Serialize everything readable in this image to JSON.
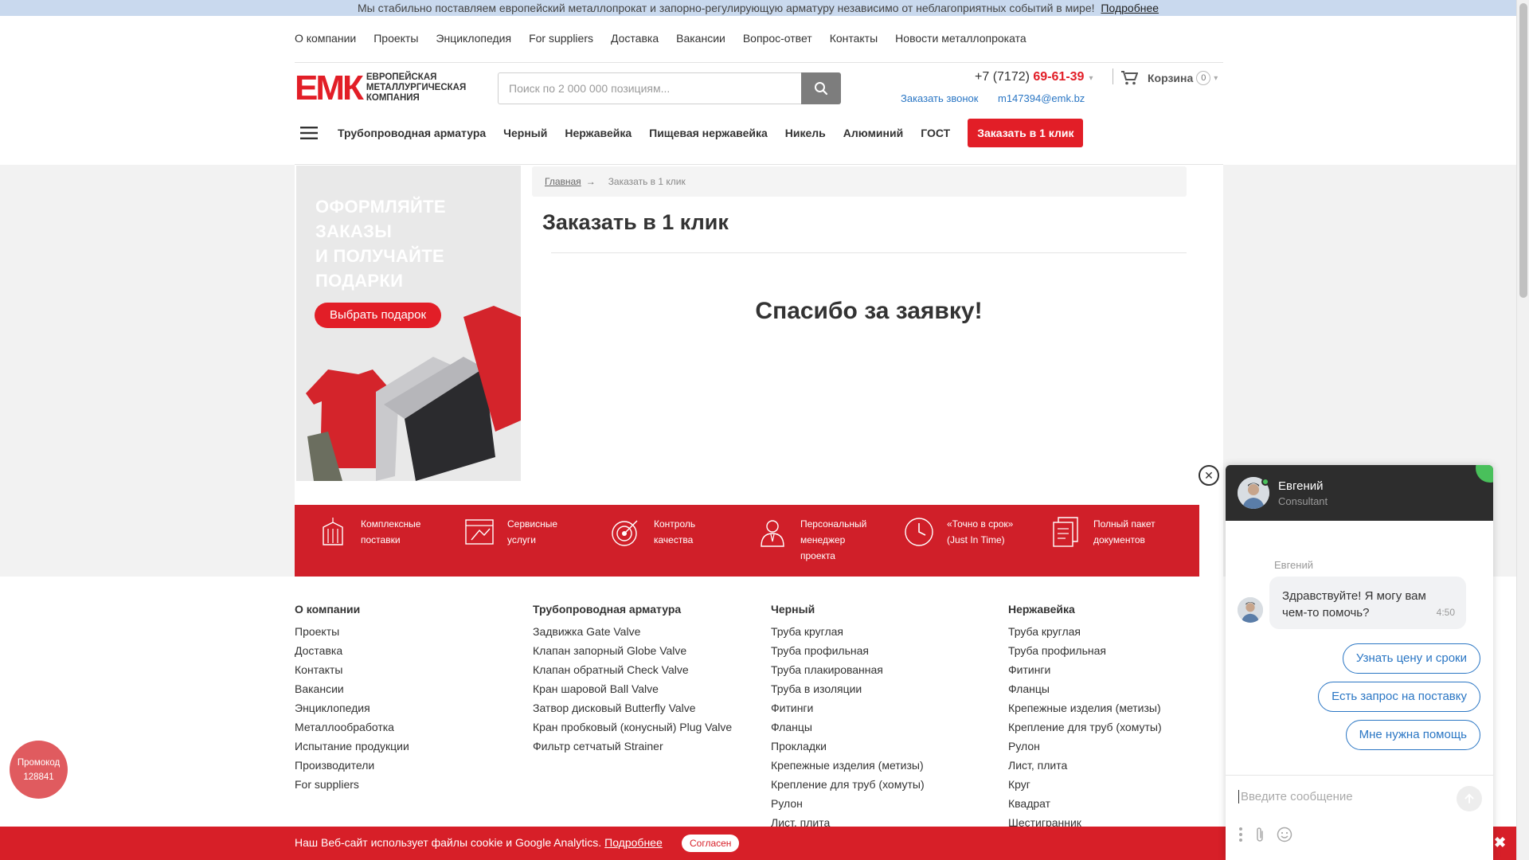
{
  "notice": {
    "text": "Мы стабильно поставляем европейский металлопрокат и запорно-регулирующую арматуру независимо от неблагоприятных событий в мире!",
    "link": "Подробнее"
  },
  "top_menu": [
    "О компании",
    "Проекты",
    "Энциклопедия",
    "For suppliers",
    "Доставка",
    "Вакансии",
    "Вопрос-ответ",
    "Контакты",
    "Новости металлопроката"
  ],
  "logo": {
    "mark": "ЕМК",
    "line1": "Европейская",
    "line2": "металлургическая",
    "line3": "компания"
  },
  "search": {
    "placeholder": "Поиск по 2 000 000 позициям..."
  },
  "contacts": {
    "phone_prefix": "+7 (7172) ",
    "phone_main": "69-61-39",
    "callback": "Заказать звонок",
    "email": "m147394@emk.bz"
  },
  "cart": {
    "label": "Корзина",
    "count": "0"
  },
  "catalog_nav": [
    "Трубопроводная арматура",
    "Черный",
    "Нержавейка",
    "Пищевая нержавейка",
    "Никель",
    "Алюминий",
    "ГОСТ"
  ],
  "order_button": "Заказать в 1 клик",
  "banner": {
    "line1": "Оформляйте",
    "line2": "заказы",
    "line3": "и получайте",
    "line4": "подарки",
    "button": "Выбрать подарок"
  },
  "breadcrumbs": {
    "home": "Главная",
    "arrow": "→",
    "current": "Заказать в 1 клик"
  },
  "page_title": "Заказать в 1 клик",
  "thanks": "Спасибо за заявку!",
  "features": [
    {
      "icon": "container-icon",
      "line1": "Комплексные",
      "line2": "поставки",
      "line3": ""
    },
    {
      "icon": "service-icon",
      "line1": "Сервисные",
      "line2": "услуги",
      "line3": ""
    },
    {
      "icon": "target-icon",
      "line1": "Контроль",
      "line2": "качества",
      "line3": ""
    },
    {
      "icon": "manager-icon",
      "line1": "Персональный",
      "line2": "менеджер",
      "line3": "проекта"
    },
    {
      "icon": "clock-icon",
      "line1": "«Точно в срок»",
      "line2": "(Just In Time)",
      "line3": ""
    },
    {
      "icon": "documents-icon",
      "line1": "Полный пакет",
      "line2": "документов",
      "line3": ""
    }
  ],
  "footer": {
    "col1": {
      "title": "О компании",
      "items": [
        "Проекты",
        "Доставка",
        "Контакты",
        "Вакансии",
        "Энциклопедия",
        "Металлообработка",
        "Испытание продукции",
        "Производители",
        "For suppliers"
      ]
    },
    "col2": {
      "title": "Трубопроводная арматура",
      "items": [
        "Задвижка Gate Valve",
        "Клапан запорный Globe Valve",
        "Клапан обратный Check Valve",
        "Кран шаровой Ball Valve",
        "Затвор дисковый Butterfly Valve",
        "Кран пробковый (конусный) Plug Valve",
        "Фильтр сетчатый Strainer"
      ]
    },
    "col3": {
      "title": "Черный",
      "items": [
        "Труба круглая",
        "Труба профильная",
        "Труба плакированная",
        "Труба в изоляции",
        "Фитинги",
        "Фланцы",
        "Прокладки",
        "Крепежные изделия (метизы)",
        "Крепление для труб (хомуты)",
        "Рулон",
        "Лист, плита"
      ]
    },
    "col4": {
      "title": "Нержавейка",
      "items": [
        "Труба круглая",
        "Труба профильная",
        "Фитинги",
        "Фланцы",
        "Крепежные изделия (метизы)",
        "Крепление для труб (хомуты)",
        "Рулон",
        "Лист, плита",
        "Круг",
        "Квадрат",
        "Шестигранник"
      ]
    }
  },
  "promo": {
    "label": "Промокод",
    "code": "128841"
  },
  "cookie": {
    "text": "Наш Веб-сайт использует файлы cookie и Google Analytics.",
    "link": "Подробнее",
    "agree": "Согласен",
    "close": "✖"
  },
  "chat": {
    "agent_name": "Евгений",
    "agent_role": "Consultant",
    "sender": "Евгений",
    "message_line1": "Здравствуйте! Я могу вам",
    "message_line2": "чем-то помочь?",
    "message_time": "4:50",
    "quick_replies": [
      "Узнать цену и сроки",
      "Есть запрос на поставку",
      "Мне нужна помощь"
    ],
    "input_placeholder": "Введите сообщение"
  },
  "colors": {
    "brand_red": "#e21e27",
    "feature_red": "#d01f29",
    "link_blue": "#2a76c4",
    "chat_header": "#2d2d2d",
    "online_green": "#49c05b"
  }
}
